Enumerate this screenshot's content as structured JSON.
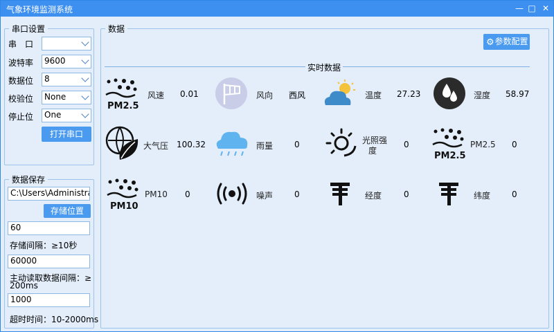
{
  "window": {
    "title": "气象环境监测系统",
    "minimize": "—",
    "maximize": "□",
    "close": "✕"
  },
  "serial": {
    "legend": "串口设置",
    "port_label": "串　口",
    "port_value": "",
    "baud_label": "波特率",
    "baud_value": "9600",
    "data_label": "数据位",
    "data_value": "8",
    "parity_label": "校验位",
    "parity_value": "None",
    "stop_label": "停止位",
    "stop_value": "One",
    "open_button": "打开串口"
  },
  "save": {
    "legend": "数据保存",
    "path": "C:\\Users\\Administrato",
    "path_button": "存储位置",
    "interval_value": "60",
    "interval_label": "存储间隔：≥10秒",
    "read_value": "60000",
    "read_label_1": "主动读取数据间隔：≥",
    "read_label_2": "200ms",
    "timeout_value": "1000",
    "timeout_label": "超时时间：10-2000ms"
  },
  "data": {
    "legend": "数据",
    "config_button": "参数配置",
    "realtime_label": "实时数据",
    "sensors": [
      {
        "name": "风速",
        "value": "0.01",
        "icon": "pm25-icon",
        "icon_text": "PM2.5"
      },
      {
        "name": "风向",
        "value": "西风",
        "icon": "wind-flag-icon"
      },
      {
        "name": "温度",
        "value": "27.23",
        "icon": "sun-cloud-icon"
      },
      {
        "name": "湿度",
        "value": "58.97",
        "icon": "humidity-drops-icon"
      },
      {
        "name": "大气压",
        "value": "100.32",
        "icon": "leaf-globe-icon"
      },
      {
        "name": "雨量",
        "value": "0",
        "icon": "rain-cloud-icon"
      },
      {
        "name": "光照强度",
        "name_1": "光照强",
        "name_2": "度",
        "value": "0",
        "icon": "sun-rays-icon"
      },
      {
        "name": "PM2.5",
        "value": "0",
        "icon": "pm25-icon",
        "icon_text": "PM2.5"
      },
      {
        "name": "PM10",
        "value": "0",
        "icon": "pm10-icon",
        "icon_text": "PM10"
      },
      {
        "name": "噪声",
        "value": "0",
        "icon": "noise-icon"
      },
      {
        "name": "经度",
        "value": "0",
        "icon": "station-icon"
      },
      {
        "name": "纬度",
        "value": "0",
        "icon": "station-icon"
      }
    ]
  }
}
